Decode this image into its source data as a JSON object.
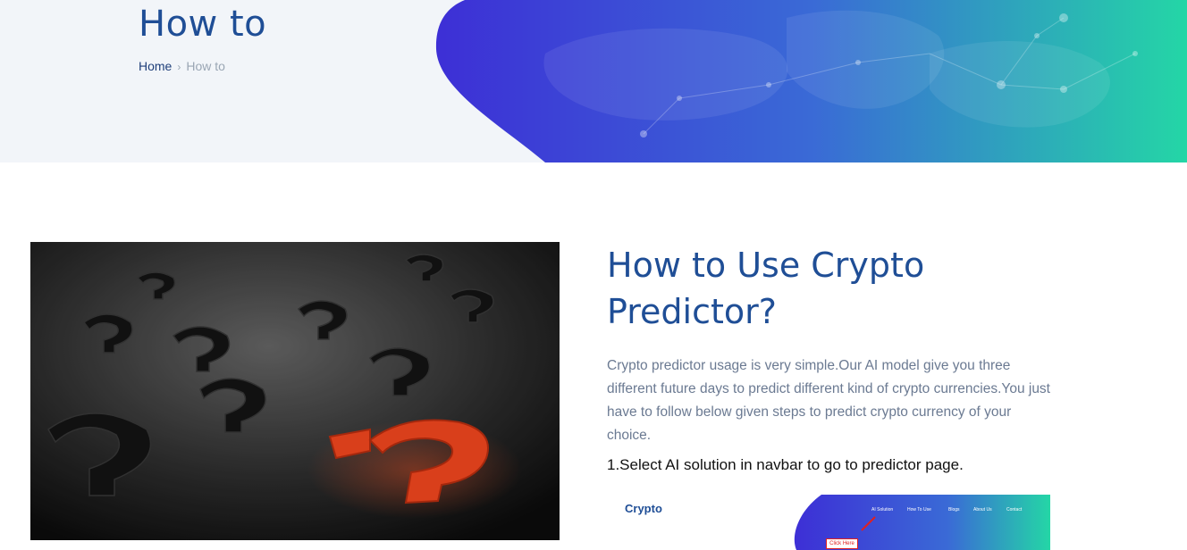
{
  "header": {
    "title": "How to",
    "breadcrumb": {
      "home": "Home",
      "separator": "›",
      "current": "How to"
    }
  },
  "main": {
    "image_alt": "Question marks scattered on a dark surface with one red question mark",
    "title": "How to Use Crypto Predictor?",
    "intro": "Crypto predictor usage is very simple.Our AI model give you three different future days to predict different kind of crypto currencies.You just have to follow below given steps to predict crypto currency of your choice.",
    "step1": "1.Select AI solution in navbar to go to predictor page.",
    "step1_screenshot": {
      "logo": "Crypto",
      "nav": [
        "AI Solution",
        "How To Use",
        "Blogs",
        "About Us",
        "Contact"
      ],
      "callout": "Click Here"
    }
  },
  "colors": {
    "title_blue": "#1f4e96",
    "gradient_start": "#3d2fd6",
    "gradient_end": "#24d6a6",
    "accent_red": "#ff4a20"
  }
}
